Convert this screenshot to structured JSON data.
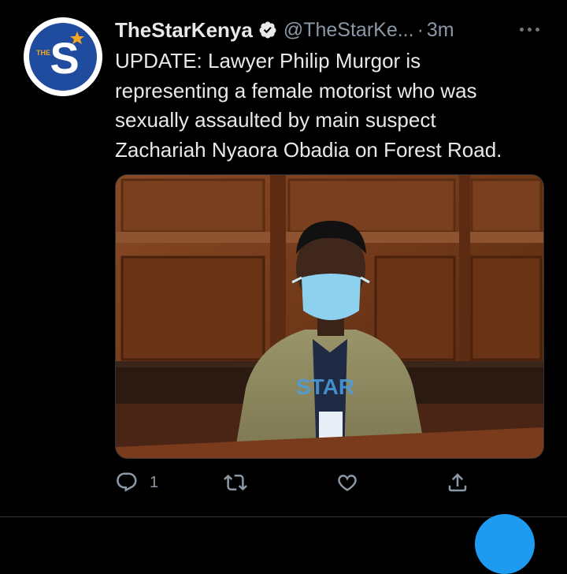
{
  "author": {
    "name": "TheStarKenya",
    "handle": "@TheStarKe...",
    "separator": "·",
    "timestamp": "3m",
    "avatar_icon": "the-star-logo-icon",
    "avatar_lettering": "S",
    "avatar_small_lettering": "THE"
  },
  "tweet": {
    "lines": [
      "UPDATE: Lawyer Philip Murgor is",
      "representing a female motorist who was",
      "sexually assaulted by main suspect",
      "Zachariah Nyaora Obadia on Forest Road."
    ]
  },
  "media": {
    "watermark": "STAR"
  },
  "actions": {
    "reply": {
      "icon": "reply-icon",
      "count": "1"
    },
    "retweet": {
      "icon": "retweet-icon"
    },
    "like": {
      "icon": "heart-icon"
    },
    "share": {
      "icon": "share-icon"
    }
  },
  "colors": {
    "background": "#000000",
    "text": "#e7e9ea",
    "secondary_text": "#8b98a5",
    "accent": "#1d9bf0",
    "logo_blue": "#1f4c9e",
    "logo_orange": "#f5a623"
  }
}
